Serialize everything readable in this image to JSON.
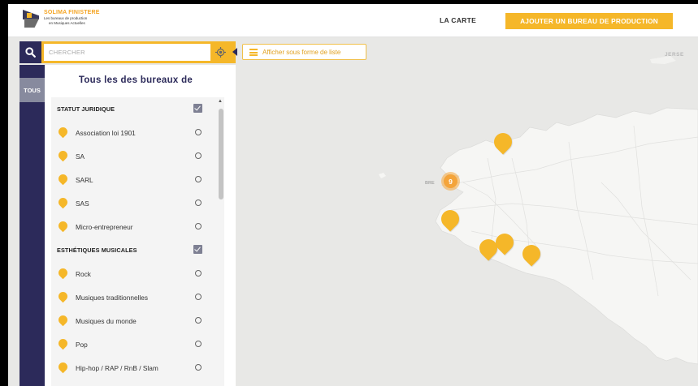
{
  "brand": {
    "name": "SOLIMA FINISTERE",
    "tagline_line1": "Les bureaux de production",
    "tagline_line2": "en Musiques Actuelles"
  },
  "nav": {
    "map_link": "LA CARTE",
    "add_button": "AJOUTER UN BUREAU DE PRODUCTION"
  },
  "search": {
    "placeholder": "CHERCHER"
  },
  "tabs": {
    "all": "TOUS"
  },
  "panel": {
    "title": "Tous les des bureaux de",
    "sections": [
      {
        "heading": "STATUT JURIDIQUE",
        "checked": true,
        "items": [
          "Association loi 1901",
          "SA",
          "SARL",
          "SAS",
          "Micro-entrepreneur"
        ]
      },
      {
        "heading": "ESTHÉTIQUES MUSICALES",
        "checked": true,
        "items": [
          "Rock",
          "Musiques traditionnelles",
          "Musiques du monde",
          "Pop",
          "Hip-hop / RAP / RnB / Slam"
        ]
      }
    ]
  },
  "map": {
    "list_toggle": "Afficher sous forme de liste",
    "labels": {
      "jersey": "JERSE",
      "brest": "BRE"
    },
    "cluster_count": "9",
    "colors": {
      "accent": "#f5b729",
      "navy": "#2c2a5a",
      "land": "#f6f6f4",
      "sea": "#e8e8e6"
    }
  }
}
